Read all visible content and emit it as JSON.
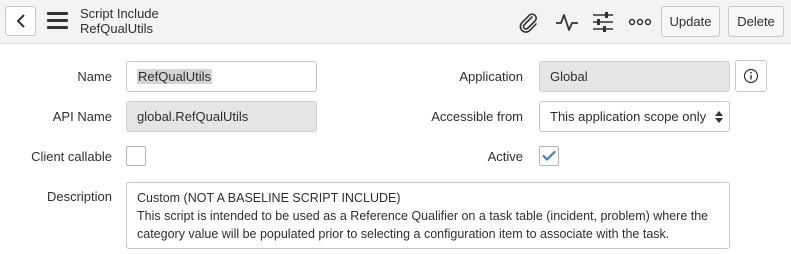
{
  "header": {
    "record_type": "Script Include",
    "record_name": "RefQualUtils",
    "update_label": "Update",
    "delete_label": "Delete",
    "icons": [
      "back-icon",
      "hamburger-icon",
      "paperclip-icon",
      "activity-icon",
      "sliders-icon",
      "more-icon"
    ]
  },
  "form": {
    "name_label": "Name",
    "name_value": "RefQualUtils",
    "api_name_label": "API Name",
    "api_name_value": "global.RefQualUtils",
    "client_callable_label": "Client callable",
    "client_callable_checked": false,
    "application_label": "Application",
    "application_value": "Global",
    "accessible_from_label": "Accessible from",
    "accessible_from_value": "This application scope only",
    "active_label": "Active",
    "active_checked": true,
    "description_label": "Description",
    "description_lines": [
      "Custom (NOT A BASELINE SCRIPT INCLUDE)",
      "This script is intended to be used as a Reference Qualifier on a task table (incident, problem) where the",
      "category value will be populated prior to selecting a configuration item to associate with the task."
    ]
  },
  "colors": {
    "checkmark": "#3b7fc4",
    "header_bg": "#f3f3f3",
    "readonly_bg": "#e5e5e5"
  }
}
